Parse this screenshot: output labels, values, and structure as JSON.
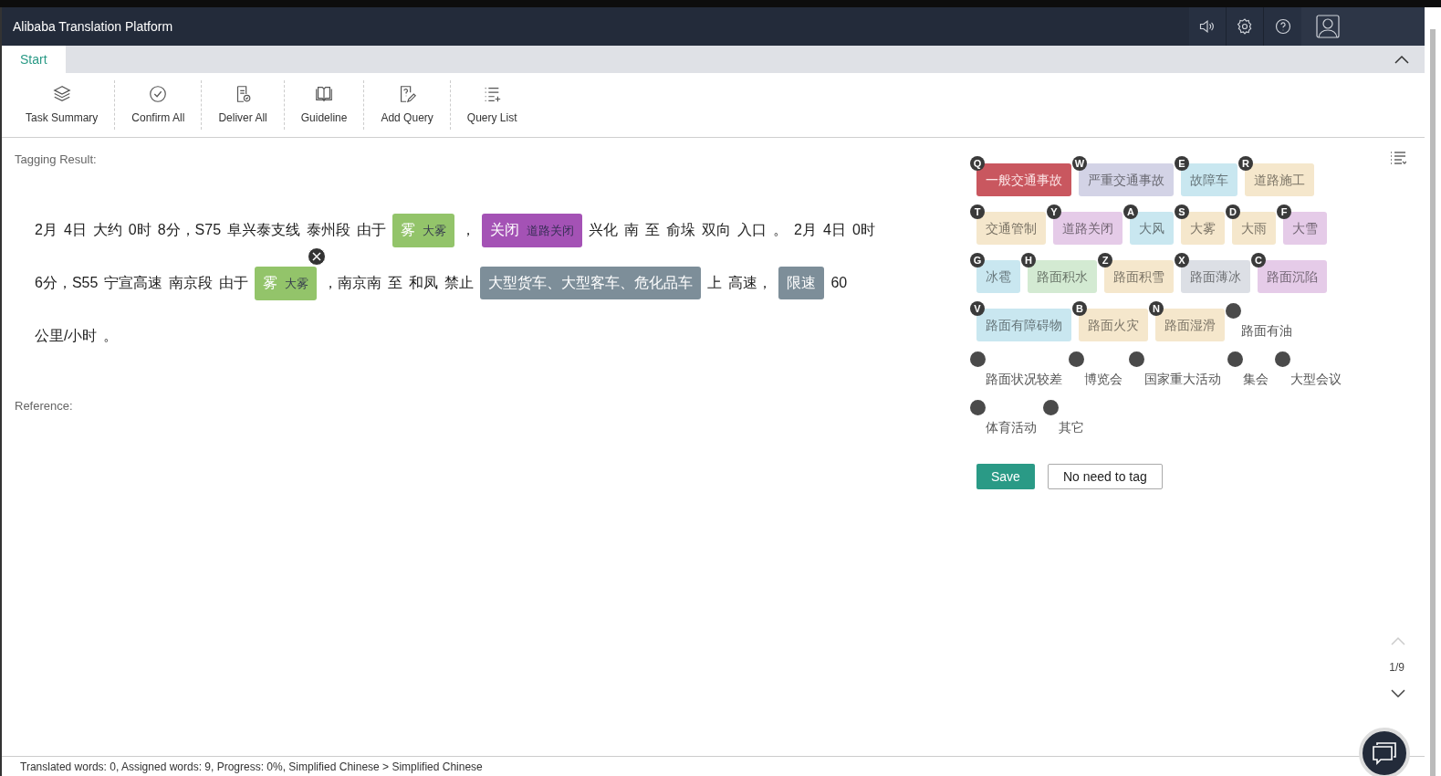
{
  "window": {
    "title": "Alibaba Translation Platform"
  },
  "tabs": [
    {
      "label": "Start",
      "selected": true
    }
  ],
  "toolbar": [
    {
      "label": "Task Summary"
    },
    {
      "label": "Confirm All"
    },
    {
      "label": "Deliver All"
    },
    {
      "label": "Guideline"
    },
    {
      "label": "Add Query"
    },
    {
      "label": "Query List"
    }
  ],
  "tagging_result": {
    "label": "Tagging Result:",
    "segments": [
      {
        "kind": "text",
        "words": [
          "2月",
          "4日",
          "大约",
          "0时",
          "8分，S75",
          "阜兴泰支线",
          "泰州段",
          "由于"
        ]
      },
      {
        "kind": "tag",
        "word": "雾",
        "label": "大雾",
        "color": "#93c46a",
        "closable": false
      },
      {
        "kind": "text",
        "words": [
          "，"
        ]
      },
      {
        "kind": "tag",
        "word": "关闭",
        "label": "道路关闭",
        "color": "#a452b5",
        "closable": false
      },
      {
        "kind": "text",
        "words": [
          "兴化",
          "南",
          "至",
          "俞垛",
          "双向",
          "入口",
          "。",
          "2月",
          "4日",
          "0时",
          "6分，S55",
          "宁宣高速",
          "南京段",
          "由于"
        ]
      },
      {
        "kind": "tag",
        "word": "雾",
        "label": "大雾",
        "color": "#93c46a",
        "closable": true
      },
      {
        "kind": "text",
        "words": [
          "，南京南",
          "至",
          "和凤",
          "禁止"
        ]
      },
      {
        "kind": "tag",
        "word": "大型货车、大型客车、危化品车",
        "color": "#7d8e99",
        "closable": false
      },
      {
        "kind": "text",
        "words": [
          "上",
          "高速，"
        ]
      },
      {
        "kind": "tag",
        "word": "限速",
        "color": "#7d8e99",
        "closable": false
      },
      {
        "kind": "text",
        "words": [
          "60",
          "公里/小时",
          "。"
        ]
      }
    ]
  },
  "reference": {
    "label": "Reference:"
  },
  "tag_palette": [
    {
      "kind": "keyed",
      "key": "Q",
      "label": "一般交通事故",
      "color": "#c9575f"
    },
    {
      "kind": "keyed",
      "key": "W",
      "label": "严重交通事故",
      "color": "#d3d3e6"
    },
    {
      "kind": "keyed",
      "key": "E",
      "label": "故障车",
      "color": "#c9e7f0"
    },
    {
      "kind": "keyed",
      "key": "R",
      "label": "道路施工",
      "color": "#f5e7cc"
    },
    {
      "kind": "keyed",
      "key": "T",
      "label": "交通管制",
      "color": "#f5e7cc"
    },
    {
      "kind": "keyed",
      "key": "Y",
      "label": "道路关闭",
      "color": "#e5cbe8"
    },
    {
      "kind": "keyed",
      "key": "A",
      "label": "大风",
      "color": "#c9e7f0"
    },
    {
      "kind": "keyed",
      "key": "S",
      "label": "大雾",
      "color": "#f5e7cc"
    },
    {
      "kind": "keyed",
      "key": "D",
      "label": "大雨",
      "color": "#f5e7cc"
    },
    {
      "kind": "keyed",
      "key": "F",
      "label": "大雪",
      "color": "#e5cbe8"
    },
    {
      "kind": "keyed",
      "key": "G",
      "label": "冰雹",
      "color": "#c9e7f0"
    },
    {
      "kind": "keyed",
      "key": "H",
      "label": "路面积水",
      "color": "#d3ead2"
    },
    {
      "kind": "keyed",
      "key": "Z",
      "label": "路面积雪",
      "color": "#f5e7cc"
    },
    {
      "kind": "keyed",
      "key": "X",
      "label": "路面薄冰",
      "color": "#dcdfe5"
    },
    {
      "kind": "keyed",
      "key": "C",
      "label": "路面沉陷",
      "color": "#e5cbe8"
    },
    {
      "kind": "keyed",
      "key": "V",
      "label": "路面有障碍物",
      "color": "#c9e7f0"
    },
    {
      "kind": "keyed",
      "key": "B",
      "label": "路面火灾",
      "color": "#f5e7cc"
    },
    {
      "kind": "keyed",
      "key": "N",
      "label": "路面湿滑",
      "color": "#f5e7cc"
    },
    {
      "kind": "plain",
      "label": "路面有油"
    },
    {
      "kind": "plain",
      "label": "路面状况较差"
    },
    {
      "kind": "plain",
      "label": "博览会"
    },
    {
      "kind": "plain",
      "label": "国家重大活动"
    },
    {
      "kind": "plain",
      "label": "集会"
    },
    {
      "kind": "plain",
      "label": "大型会议"
    },
    {
      "kind": "plain",
      "label": "体育活动"
    },
    {
      "kind": "plain",
      "label": "其它"
    }
  ],
  "actions": [
    {
      "label": "Save",
      "kind": "primary"
    },
    {
      "label": "No need to tag",
      "kind": "secondary"
    }
  ],
  "pager": {
    "text": "1/9"
  },
  "status_bar": "Translated words: 0, Assigned words: 9, Progress: 0%, Simplified Chinese > Simplified Chinese"
}
